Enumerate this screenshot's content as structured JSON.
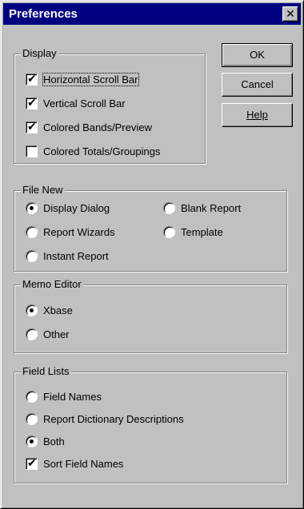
{
  "window": {
    "title": "Preferences",
    "close_glyph": "✕"
  },
  "display": {
    "legend": "Display",
    "items": [
      {
        "label": "Horizontal Scroll Bar",
        "checked": true
      },
      {
        "label": "Vertical Scroll Bar",
        "checked": true
      },
      {
        "label": "Colored Bands/Preview",
        "checked": true
      },
      {
        "label": "Colored Totals/Groupings",
        "checked": false
      }
    ]
  },
  "file_new": {
    "legend": "File New",
    "options": [
      {
        "label": "Display Dialog",
        "selected": true
      },
      {
        "label": "Report Wizards",
        "selected": false
      },
      {
        "label": "Instant Report",
        "selected": false
      },
      {
        "label": "Blank Report",
        "selected": false
      },
      {
        "label": "Template",
        "selected": false
      }
    ]
  },
  "memo_editor": {
    "legend": "Memo Editor",
    "options": [
      {
        "label": "Xbase",
        "selected": true
      },
      {
        "label": "Other",
        "selected": false
      }
    ]
  },
  "field_lists": {
    "legend": "Field Lists",
    "options": [
      {
        "label": "Field Names",
        "selected": false
      },
      {
        "label": "Report Dictionary Descriptions",
        "selected": false
      },
      {
        "label": "Both",
        "selected": true
      }
    ],
    "sort_checkbox": {
      "label": "Sort Field Names",
      "checked": true
    }
  },
  "buttons": {
    "ok": "OK",
    "cancel": "Cancel",
    "help": "Help"
  },
  "check_glyph": "✔"
}
